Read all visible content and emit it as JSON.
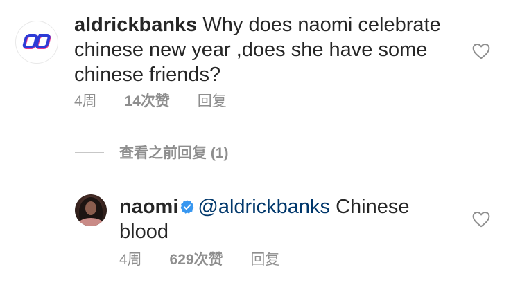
{
  "comments": [
    {
      "username": "aldrickbanks",
      "text": "Why does naomi celebrate chinese new year ,does she have some chinese friends?",
      "time": "4周",
      "likes": "14次赞",
      "reply_label": "回复",
      "avatar_logo": "ob"
    }
  ],
  "view_replies_label": "查看之前回复 (1)",
  "reply": {
    "username": "naomi",
    "verified": true,
    "mention": "@aldrickbanks",
    "text": " Chinese blood",
    "time": "4周",
    "likes": "629次赞",
    "reply_label": "回复"
  },
  "colors": {
    "text": "#262626",
    "muted": "#8e8e8e",
    "mention": "#00376b",
    "verified_badge": "#3897f0",
    "logo_blue": "#2d3bd6",
    "logo_pink": "#e8358f"
  },
  "icons": {
    "like": "heart-outline-icon",
    "verified": "verified-badge-icon"
  }
}
